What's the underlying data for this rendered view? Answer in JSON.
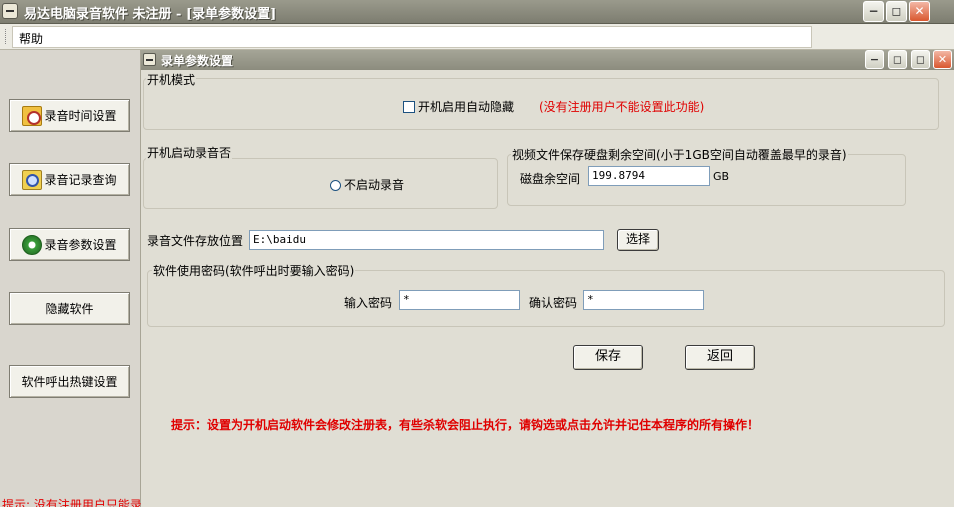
{
  "window": {
    "title": "易达电脑录音软件 未注册 - [录单参数设置]",
    "controls": {
      "minimize": "−",
      "restore": "◻",
      "close": "✕"
    }
  },
  "menu": {
    "items": [
      {
        "label": "帮助"
      }
    ]
  },
  "sidebar": {
    "items": [
      {
        "label": "录音时间设置",
        "icon": "clock-icon"
      },
      {
        "label": "录音记录查询",
        "icon": "search-icon"
      },
      {
        "label": "录音参数设置",
        "icon": "settings-icon"
      },
      {
        "label": "隐藏软件"
      },
      {
        "label": "软件呼出热键设置"
      }
    ],
    "tip": "提示: 没有注册用户只能录"
  },
  "child_window": {
    "title": "录单参数设置",
    "controls": {
      "minimize": "−",
      "restore": "◻",
      "close": "✕"
    }
  },
  "startup_mode": {
    "label": "开机模式",
    "checkbox_label": "开机启用自动隐藏",
    "checkbox_checked": false,
    "notice": "(没有注册用户不能设置此功能)"
  },
  "startup_record": {
    "label": "开机启动录音否",
    "radio_label": "不启动录音",
    "radio_selected": false
  },
  "disk_space": {
    "label": "视频文件保存硬盘剩余空间(小于1GB空间自动覆盖最早的录音)",
    "field_label": "磁盘余空间",
    "value": "199.8794",
    "unit": "GB"
  },
  "storage": {
    "label": "录音文件存放位置",
    "path": "E:\\baidu",
    "choose_button": "选择"
  },
  "password": {
    "group_label": "软件使用密码(软件呼出时要输入密码)",
    "input_label": "输入密码",
    "input_value": "*",
    "confirm_label": "确认密码",
    "confirm_value": "*"
  },
  "actions": {
    "save": "保存",
    "back": "返回"
  },
  "hint": "提示：设置为开机启动软件会修改注册表，有些杀软会阻止执行，请钩选或点击允许并记住本程序的所有操作！",
  "colors": {
    "warning": "#e00000",
    "titlebar": "#8c8c7e",
    "background": "#e0ded4"
  }
}
